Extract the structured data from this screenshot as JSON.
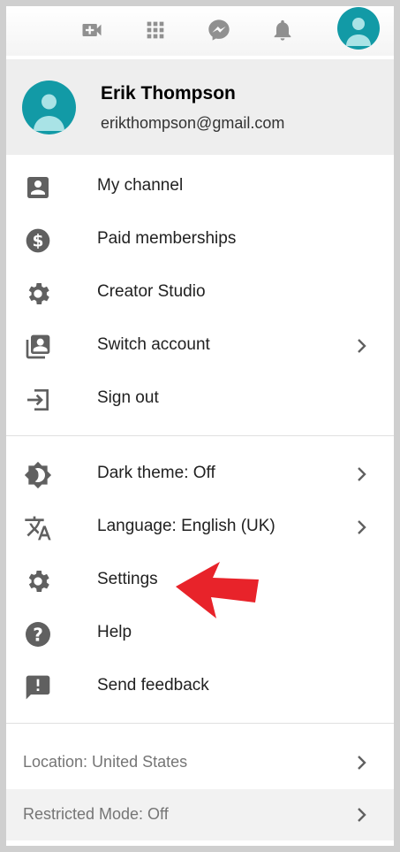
{
  "topbar": {
    "icons": [
      "video-add-icon",
      "apps-grid-icon",
      "messages-icon",
      "notifications-bell-icon",
      "avatar"
    ]
  },
  "account": {
    "name": "Erik Thompson",
    "email": "erikthompson@gmail.com"
  },
  "menu_section_1": [
    {
      "label": "My channel",
      "icon": "account-box-icon",
      "has_chevron": false
    },
    {
      "label": "Paid memberships",
      "icon": "dollar-circle-icon",
      "has_chevron": false
    },
    {
      "label": "Creator Studio",
      "icon": "gear-icon",
      "has_chevron": false
    },
    {
      "label": "Switch account",
      "icon": "switch-account-icon",
      "has_chevron": true
    },
    {
      "label": "Sign out",
      "icon": "sign-out-icon",
      "has_chevron": false
    }
  ],
  "menu_section_2": [
    {
      "label": "Dark theme: Off",
      "icon": "brightness-icon",
      "has_chevron": true
    },
    {
      "label": "Language: English (UK)",
      "icon": "translate-icon",
      "has_chevron": true
    },
    {
      "label": "Settings",
      "icon": "gear-icon",
      "has_chevron": false
    },
    {
      "label": "Help",
      "icon": "help-icon",
      "has_chevron": false
    },
    {
      "label": "Send feedback",
      "icon": "feedback-icon",
      "has_chevron": false
    }
  ],
  "footer": {
    "location": "Location: United States",
    "restricted": "Restricted Mode: Off"
  },
  "colors": {
    "accent_avatar": "#129aa6",
    "icon_gray": "#606060",
    "highlight_arrow": "#e8232a"
  }
}
